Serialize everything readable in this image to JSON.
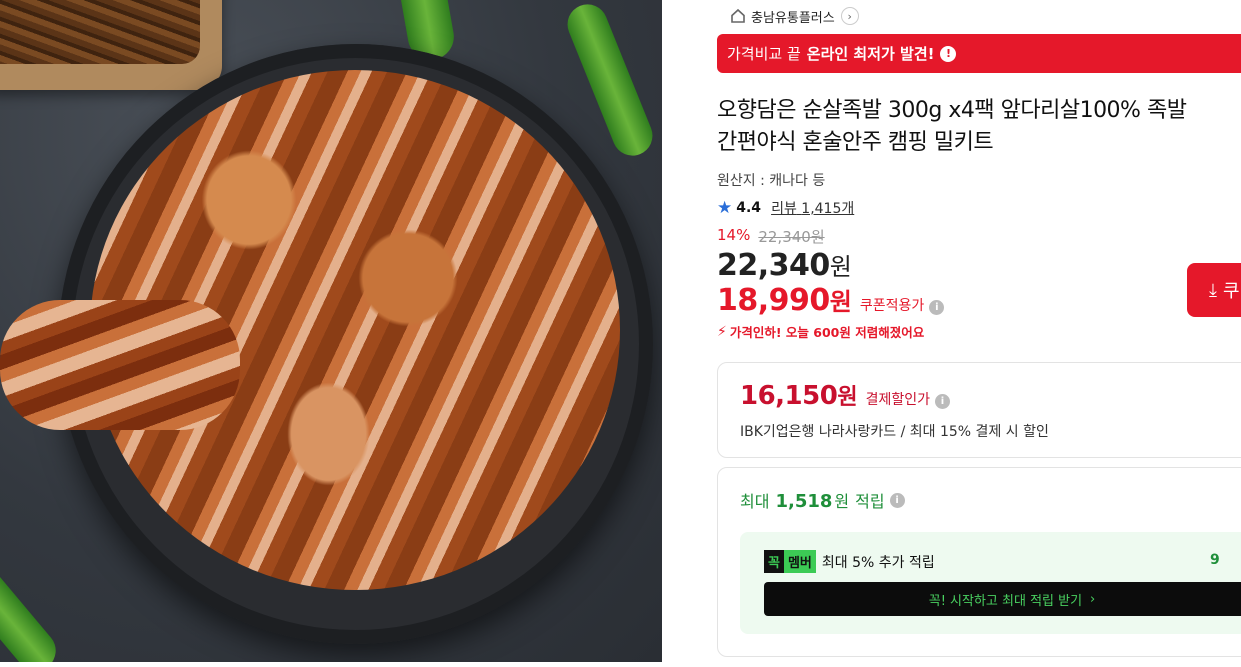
{
  "seller": {
    "name": "충남유통플러스",
    "home_icon": "home-icon",
    "chevron": "›"
  },
  "banner": {
    "prefix": "가격비교 끝",
    "highlight": "온라인 최저가 발견!",
    "info": "!"
  },
  "product": {
    "title_line1": "오향담은 순살족발 300g x4팩 앞다리살100% 족발",
    "title_line2": "간편야식 혼술안주 캠핑 밀키트",
    "origin": "원산지 : 캐나다 등"
  },
  "rating": {
    "score": "4.4",
    "review_label": "리뷰",
    "review_count": "1,415개"
  },
  "price": {
    "discount_rate": "14%",
    "original": "22,340원",
    "sale_amount": "22,340",
    "unit": "원",
    "coupon_amount": "18,990",
    "coupon_label": "쿠폰적용가",
    "price_drop": "가격인하! 오늘 600원 저렴해졌어요"
  },
  "download_button": {
    "label": "쿠"
  },
  "card_discount": {
    "amount": "16,150",
    "unit": "원",
    "label": "결제할인가",
    "desc": "IBK기업은행 나라사랑카드 / 최대 15% 결제 시 할인"
  },
  "reward": {
    "prefix": "최대",
    "points": "1,518",
    "unit": "원",
    "label": "적립",
    "member": {
      "badge_k": "꼭",
      "badge_m": "멤버",
      "text": "최대 5% 추가 적립",
      "right_value": "9",
      "cta": "꼭! 시작하고 최대 적립 받기",
      "cta_arrow": "›"
    }
  },
  "colors": {
    "accent_red": "#e5182a",
    "reward_green": "#1f8f3a",
    "rating_blue": "#2a6ed8"
  }
}
